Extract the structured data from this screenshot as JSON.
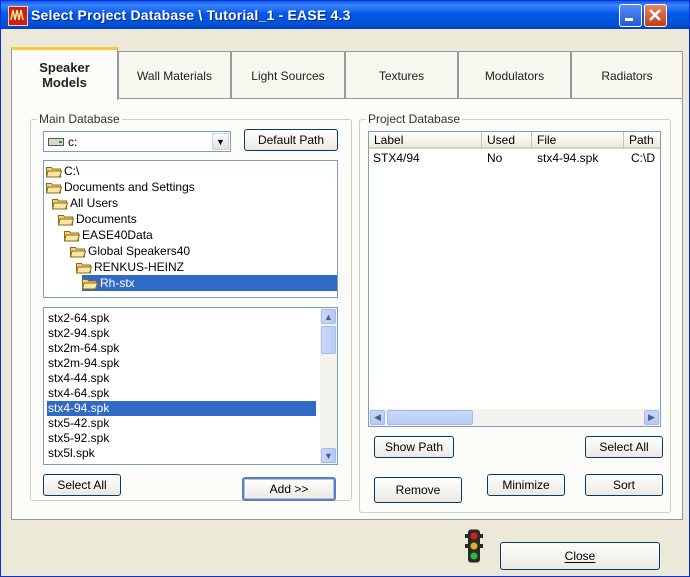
{
  "window": {
    "title": "Select Project Database \\ Tutorial_1 - EASE 4.3",
    "close_label": "Close"
  },
  "tabs": [
    {
      "label": "Speaker Models",
      "active": true
    },
    {
      "label": "Wall Materials",
      "active": false
    },
    {
      "label": "Light Sources",
      "active": false
    },
    {
      "label": "Textures",
      "active": false
    },
    {
      "label": "Modulators",
      "active": false
    },
    {
      "label": "Radiators",
      "active": false
    }
  ],
  "main_database": {
    "group_label": "Main Database",
    "drive_value": "c:",
    "default_path_label": "Default Path",
    "folders": [
      {
        "label": "C:\\",
        "selected": false
      },
      {
        "label": "Documents and Settings",
        "selected": false
      },
      {
        "label": "All Users",
        "selected": false
      },
      {
        "label": "Documents",
        "selected": false
      },
      {
        "label": "EASE40Data",
        "selected": false
      },
      {
        "label": "Global Speakers40",
        "selected": false
      },
      {
        "label": "RENKUS-HEINZ",
        "selected": false
      },
      {
        "label": "Rh-stx",
        "selected": true
      }
    ],
    "files": [
      {
        "name": "stx2-64.spk",
        "selected": false
      },
      {
        "name": "stx2-94.spk",
        "selected": false
      },
      {
        "name": "stx2m-64.spk",
        "selected": false
      },
      {
        "name": "stx2m-94.spk",
        "selected": false
      },
      {
        "name": "stx4-44.spk",
        "selected": false
      },
      {
        "name": "stx4-64.spk",
        "selected": false
      },
      {
        "name": "stx4-94.spk",
        "selected": true
      },
      {
        "name": "stx5-42.spk",
        "selected": false
      },
      {
        "name": "stx5-92.spk",
        "selected": false
      },
      {
        "name": "stx5l.spk",
        "selected": false
      }
    ],
    "select_all_label": "Select All",
    "add_label": "Add >>"
  },
  "project_database": {
    "group_label": "Project Database",
    "columns": [
      "Label",
      "Used",
      "File",
      "Path"
    ],
    "rows": [
      {
        "label": "STX4/94",
        "used": "No",
        "file": "stx4-94.spk",
        "path": "C:\\D"
      }
    ],
    "show_path_label": "Show Path",
    "select_all_label": "Select All",
    "remove_label": "Remove",
    "minimize_label": "Minimize",
    "sort_label": "Sort"
  },
  "colors": {
    "selection": "#316ac5",
    "title_bar": "#0458e6",
    "dialog_bg": "#ece9d8"
  }
}
